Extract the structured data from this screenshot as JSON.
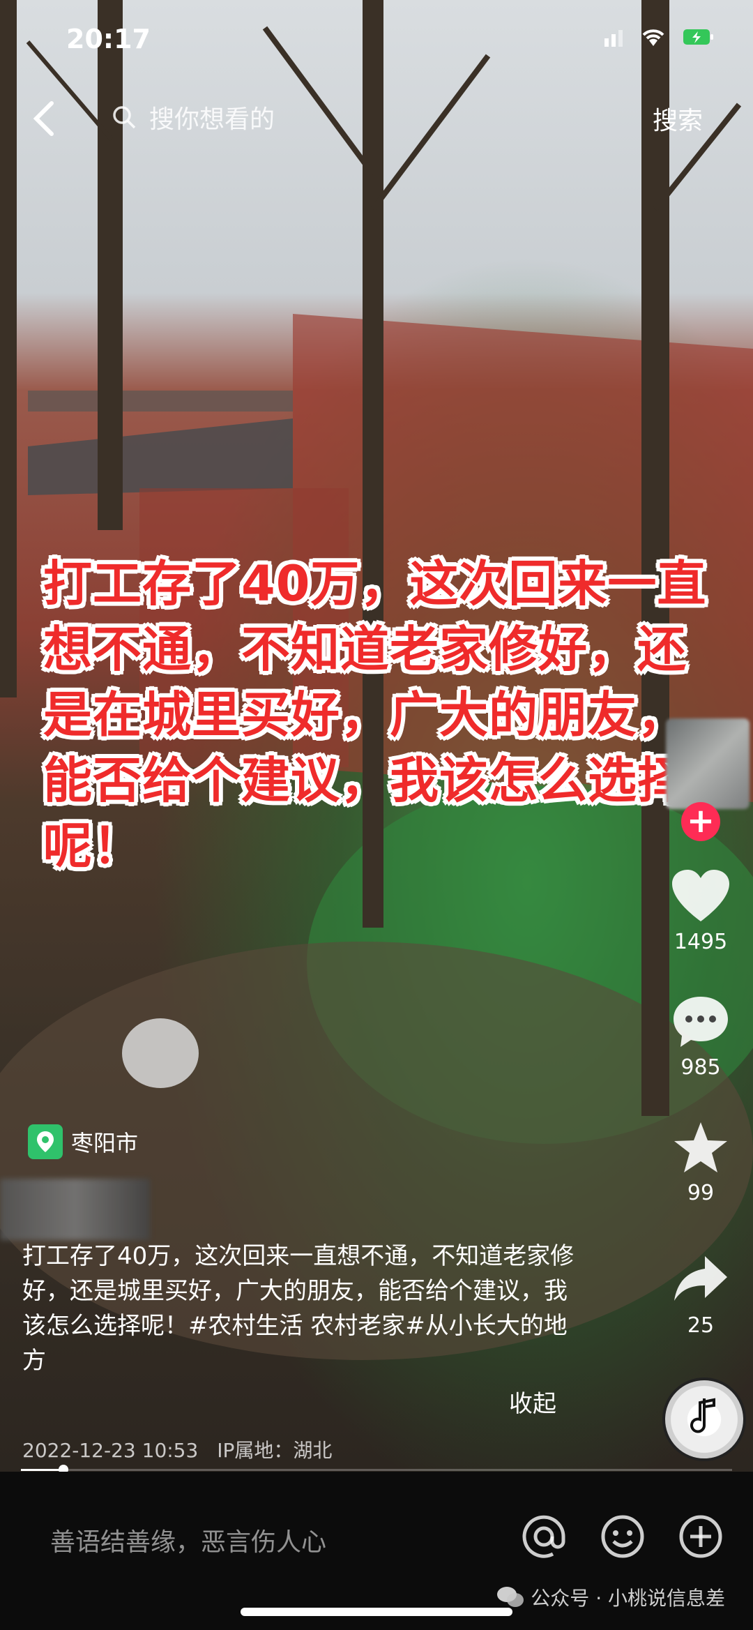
{
  "status_bar": {
    "time": "20:17"
  },
  "search": {
    "placeholder": "搜你想看的",
    "button_label": "搜索"
  },
  "video": {
    "overlay_caption": "打工存了40万，这次回来一直想不通，不知道老家修好，还是在城里买好，广大的朋友，能否给个建议，我该怎么选择呢！"
  },
  "actions": {
    "likes": "1495",
    "comments": "985",
    "favorites": "99",
    "shares": "25"
  },
  "location": {
    "name": "枣阳市"
  },
  "description": {
    "text": "打工存了40万，这次回来一直想不通，不知道老家修好，还是城里买好，广大的朋友，能否给个建议，我该怎么选择呢！#农村生活 农村老家#从小长大的地方",
    "collapse_label": "收起",
    "timestamp": "2022-12-23 10:53",
    "ip_location": "IP属地：湖北"
  },
  "playback": {
    "progress_fraction": 0.06
  },
  "comment_bar": {
    "placeholder": "善语结善缘，恶言伤人心"
  },
  "watermark": {
    "text": "公众号 · 小桃说信息差"
  },
  "icons": [
    "back-icon",
    "search-icon",
    "signal-icon",
    "wifi-icon",
    "battery-icon",
    "follow-plus-icon",
    "heart-icon",
    "comment-icon",
    "star-icon",
    "share-icon",
    "music-disc-icon",
    "location-pin-icon",
    "at-icon",
    "emoji-icon",
    "add-icon",
    "wechat-icon"
  ],
  "colors": {
    "accent_red": "#fe2c55",
    "location_green": "#2fc26b",
    "caption_red": "#ef2b2b"
  }
}
